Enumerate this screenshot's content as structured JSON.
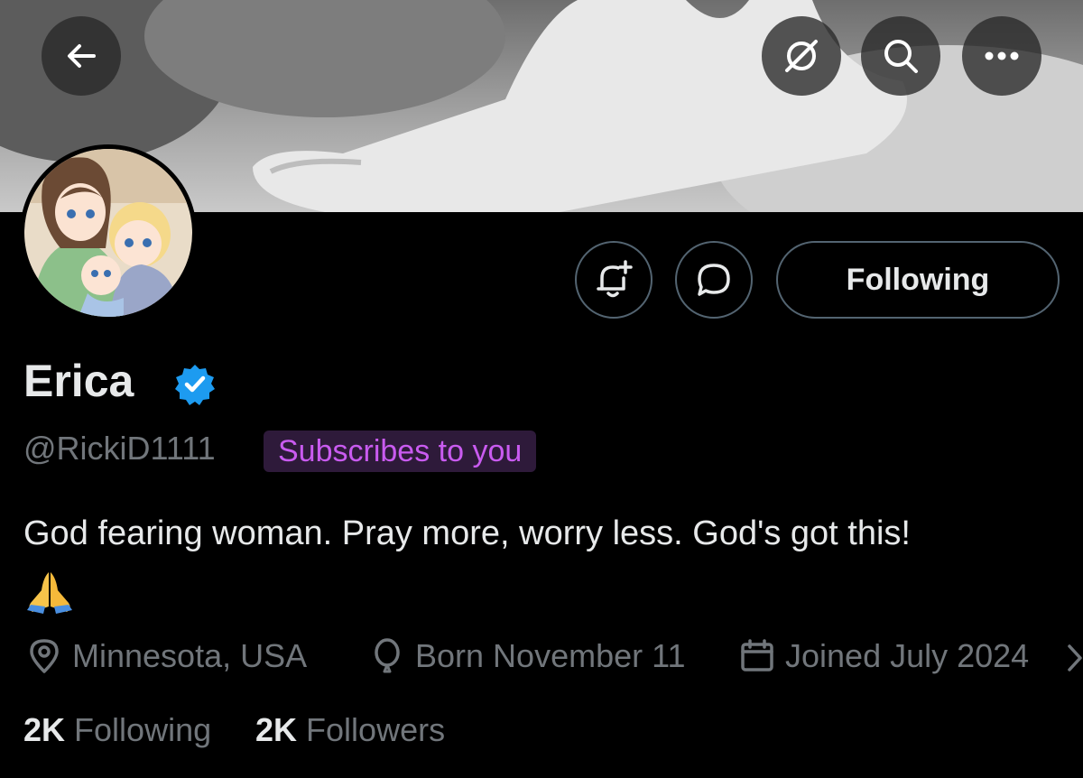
{
  "profile": {
    "name": "Erica",
    "handle": "@RickiD1111",
    "subscribes_badge": "Subscribes to you",
    "bio": "God fearing woman. Pray more, worry less. God's got this!",
    "bio_emoji": "praying-hands-emoji",
    "location": "Minnesota, USA",
    "birthday": "Born November 11",
    "joined": "Joined July 2024",
    "following_count": "2K",
    "following_label": "Following",
    "followers_count": "2K",
    "followers_label": "Followers"
  },
  "actions": {
    "follow_state_label": "Following"
  },
  "icons": {
    "back": "back-arrow-icon",
    "mute": "slashed-circle-icon",
    "search": "search-icon",
    "more": "more-dots-icon",
    "notify": "bell-plus-icon",
    "message": "chat-bubble-icon",
    "verified": "verified-badge-icon",
    "location": "location-pin-icon",
    "balloon": "balloon-icon",
    "calendar": "calendar-icon"
  },
  "colors": {
    "background": "#000000",
    "text_primary": "#e7e9ea",
    "text_secondary": "#71767b",
    "verified_blue": "#1d9bf0",
    "badge_text": "#c95bf0",
    "badge_bg": "#2e1a3a",
    "border": "#536471"
  }
}
